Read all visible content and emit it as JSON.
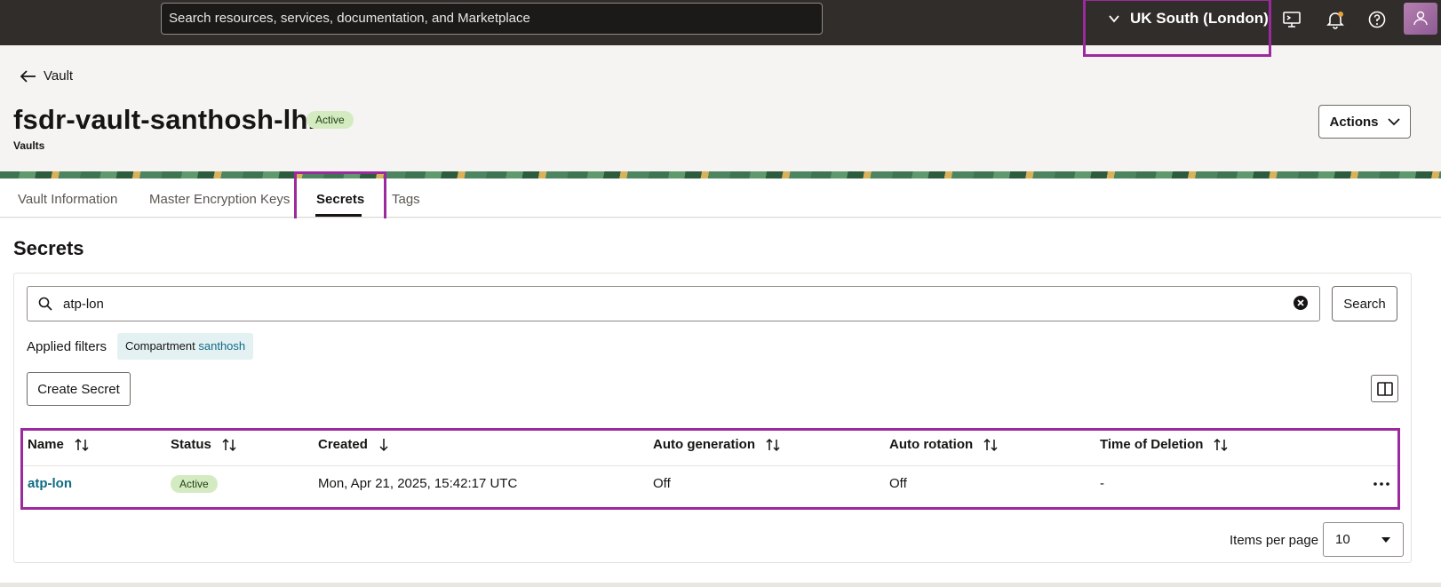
{
  "topbar": {
    "search_placeholder": "Search resources, services, documentation, and Marketplace",
    "region": "UK South (London)",
    "icons": [
      "cloud-shell-icon",
      "bell-icon",
      "help-icon",
      "avatar"
    ]
  },
  "header": {
    "back_label": "Vault",
    "title": "fsdr-vault-santhosh-lhr",
    "status": "Active",
    "subtitle": "Vaults",
    "actions_label": "Actions"
  },
  "tabs": [
    {
      "label": "Vault Information",
      "active": false
    },
    {
      "label": "Master Encryption Keys",
      "active": false
    },
    {
      "label": "Secrets",
      "active": true
    },
    {
      "label": "Tags",
      "active": false
    }
  ],
  "secrets": {
    "section_title": "Secrets",
    "filter_value": "atp-lon",
    "search_label": "Search",
    "applied_filters_label": "Applied filters",
    "chip_key": "Compartment",
    "chip_value": "santhosh",
    "create_label": "Create Secret",
    "columns": [
      "Name",
      "Status",
      "Created",
      "Auto generation",
      "Auto rotation",
      "Time of Deletion"
    ],
    "rows": [
      {
        "name": "atp-lon",
        "status": "Active",
        "created": "Mon, Apr 21, 2025, 15:42:17 UTC",
        "auto_generation": "Off",
        "auto_rotation": "Off",
        "time_of_deletion": "-"
      }
    ],
    "items_per_page_label": "Items per page",
    "items_per_page": "10"
  },
  "colors": {
    "topbar": "#312d2a",
    "highlight": "#9c2a9e",
    "link": "#0f6b84",
    "badge": "#d4ebc2"
  }
}
